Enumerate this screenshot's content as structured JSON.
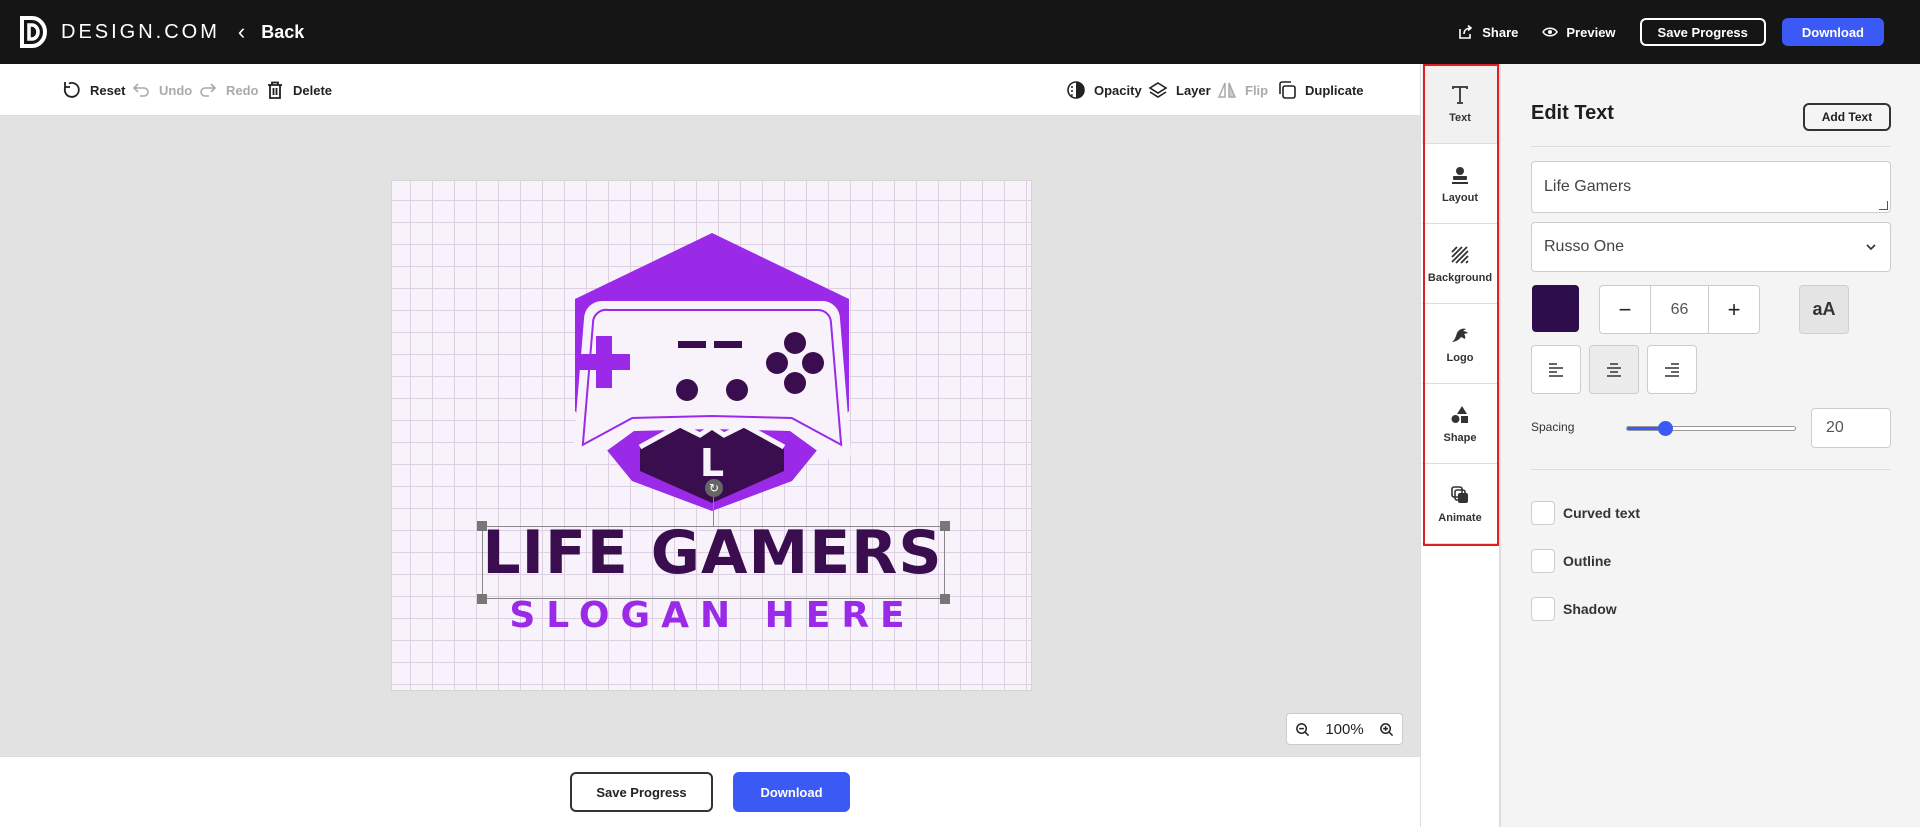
{
  "header": {
    "brand": "DESIGN.COM",
    "back_label": "Back",
    "share_label": "Share",
    "preview_label": "Preview",
    "save_progress_label": "Save Progress",
    "download_label": "Download"
  },
  "toolbar": {
    "reset": "Reset",
    "undo": "Undo",
    "redo": "Redo",
    "delete": "Delete",
    "opacity": "Opacity",
    "layer": "Layer",
    "flip": "Flip",
    "duplicate": "Duplicate"
  },
  "canvas": {
    "logo_letter": "L",
    "main_text": "LIFE GAMERS",
    "slogan_text": "SLOGAN HERE",
    "zoom_level": "100%",
    "colors": {
      "primary_purple": "#9b2ae8",
      "dark_purple": "#3a0d4f",
      "artboard_bg": "#f8f2fa"
    }
  },
  "bottom": {
    "save_progress_label": "Save Progress",
    "download_label": "Download"
  },
  "side_tabs": [
    {
      "label": "Text",
      "icon": "text-icon"
    },
    {
      "label": "Layout",
      "icon": "layout-icon"
    },
    {
      "label": "Background",
      "icon": "background-icon"
    },
    {
      "label": "Logo",
      "icon": "logo-icon"
    },
    {
      "label": "Shape",
      "icon": "shape-icon"
    },
    {
      "label": "Animate",
      "icon": "animate-icon"
    }
  ],
  "panel": {
    "title": "Edit Text",
    "add_text_label": "Add Text",
    "text_value": "Life Gamers",
    "font_value": "Russo One",
    "color_value": "#2d0d4b",
    "font_size": "66",
    "case_label": "aA",
    "spacing_label": "Spacing",
    "spacing_value": "20",
    "spacing_fraction": 0.2,
    "curved_label": "Curved text",
    "outline_label": "Outline",
    "shadow_label": "Shadow"
  }
}
